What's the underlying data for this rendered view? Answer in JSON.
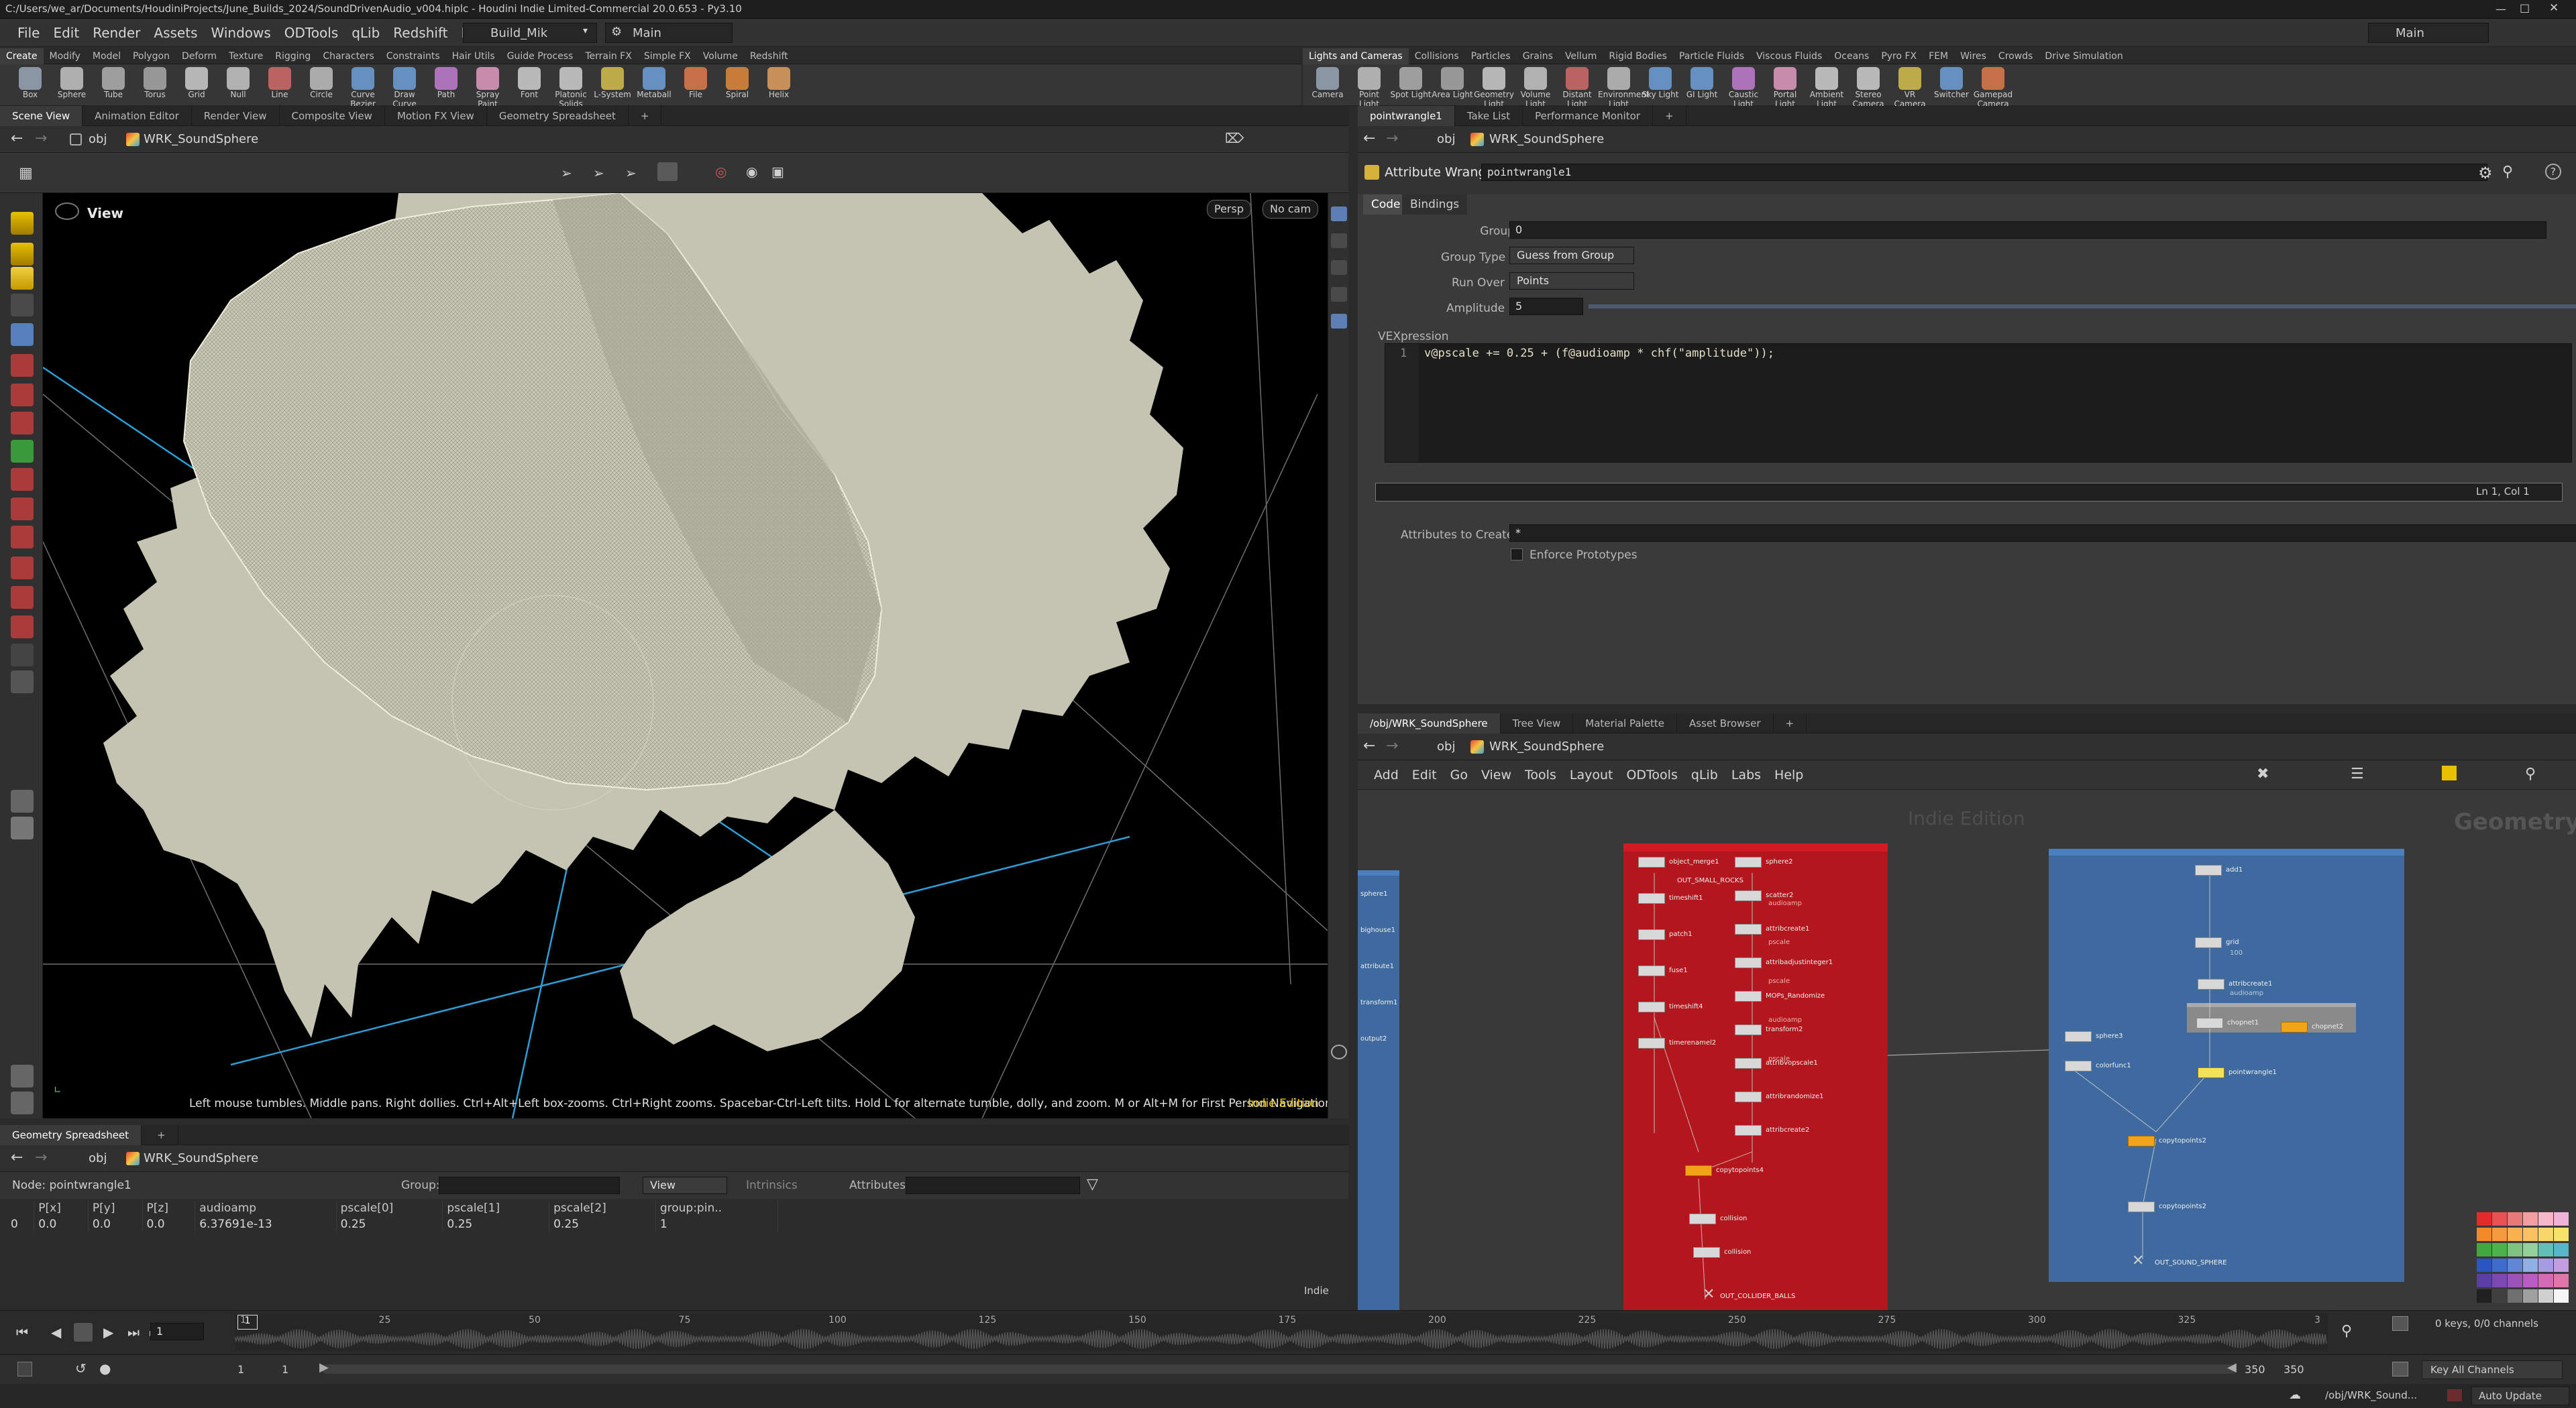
{
  "window": {
    "title": "C:/Users/we_ar/Documents/HoudiniProjects/June_Builds_2024/SoundDrivenAudio_v004.hiplc - Houdini Indie Limited-Commercial 20.0.653 - Py3.10"
  },
  "menu": {
    "items": [
      "File",
      "Edit",
      "Render",
      "Assets",
      "Windows",
      "ODTools",
      "qLib",
      "Redshift",
      "Labs",
      "Help"
    ],
    "desktop": "Build_Mik",
    "main_selector": "Main",
    "right_desktop": "Main"
  },
  "shelf_left": {
    "tabs": [
      "Create",
      "Modify",
      "Model",
      "Polygon",
      "Deform",
      "Texture",
      "Rigging",
      "Characters",
      "Constraints",
      "Hair Utils",
      "Guide Process",
      "Terrain FX",
      "Simple FX",
      "Volume",
      "Redshift"
    ],
    "tools": [
      "Box",
      "Sphere",
      "Tube",
      "Torus",
      "Grid",
      "Null",
      "Line",
      "Circle",
      "Curve Bezier",
      "Draw Curve",
      "Path",
      "Spray Paint",
      "Font",
      "Platonic Solids",
      "L-System",
      "Metaball",
      "File",
      "Spiral",
      "Helix"
    ]
  },
  "shelf_right": {
    "tabs": [
      "Lights and Cameras",
      "Collisions",
      "Particles",
      "Grains",
      "Vellum",
      "Rigid Bodies",
      "Particle Fluids",
      "Viscous Fluids",
      "Oceans",
      "Pyro FX",
      "FEM",
      "Wires",
      "Crowds",
      "Drive Simulation"
    ],
    "tools": [
      "Camera",
      "Point Light",
      "Spot Light",
      "Area Light",
      "Geometry Light",
      "Volume Light",
      "Distant Light",
      "Environment Light",
      "Sky Light",
      "GI Light",
      "Caustic Light",
      "Portal Light",
      "Ambient Light",
      "Stereo Camera",
      "VR Camera",
      "Switcher",
      "Gamepad Camera"
    ]
  },
  "scene_tabs": [
    "Scene View",
    "Animation Editor",
    "Render View",
    "Composite View",
    "Motion FX View",
    "Geometry Spreadsheet"
  ],
  "param_tabs": [
    "pointwrangle1",
    "Take List",
    "Performance Monitor"
  ],
  "network_tabs": [
    "/obj/WRK_SoundSphere",
    "Tree View",
    "Material Palette",
    "Asset Browser"
  ],
  "path": {
    "context": "obj",
    "node": "WRK_SoundSphere"
  },
  "viewport": {
    "label": "View",
    "persp": "Persp",
    "cam": "No cam",
    "hint": "Left mouse tumbles. Middle pans. Right dollies. Ctrl+Alt+Left box-zooms. Ctrl+Right zooms. Spacebar-Ctrl-Left tilts. Hold L for alternate tumble, dolly, and zoom.  M or Alt+M for First Person Navigation.",
    "edition": "Indie Edition"
  },
  "params": {
    "type_label": "Attribute Wrangle",
    "node_name": "pointwrangle1",
    "tabs": [
      "Code",
      "Bindings"
    ],
    "group_label": "Group",
    "group_value": "0",
    "group_type_label": "Group Type",
    "group_type_value": "Guess from Group",
    "run_over_label": "Run Over",
    "run_over_value": "Points",
    "amplitude_label": "Amplitude",
    "amplitude_value": "5",
    "vex_label": "VEXpression",
    "code_line_no": "1",
    "code": "v@pscale += 0.25 + (f@audioamp * chf(\"amplitude\"));",
    "cursor_pos": "Ln 1, Col 1",
    "attrs_label": "Attributes to Create",
    "attrs_value": "*",
    "enforce_label": "Enforce Prototypes"
  },
  "network": {
    "menu": [
      "Add",
      "Edit",
      "Go",
      "View",
      "Tools",
      "Layout",
      "ODTools",
      "qLib",
      "Labs",
      "Help"
    ],
    "watermark": "Indie Edition",
    "context_label": "Geometry",
    "left_nodes": [
      "sphere1",
      "bighouse1",
      "attribute1",
      "transform1",
      "output2"
    ],
    "red_col1": [
      "object_merge1",
      "timeshift1",
      "patch1",
      "fuse1",
      "timeshift4",
      "timerenamel2"
    ],
    "red_col1_sub": "OUT_SMALL_ROCKS",
    "red_col2": [
      "sphere2",
      "scatter2",
      "attribcreate1",
      "attribadjustinteger1",
      "MOPs_Randomize",
      "transform2",
      "attribvopscale1",
      "attribrandomize1",
      "attribcreate2"
    ],
    "red_col2_sub": [
      "audioamp",
      "pscale",
      "pscale",
      "audioamp",
      "pscale"
    ],
    "red_bottom": [
      "copytopoints4",
      "collision",
      "OUT_COLLIDER_BALLS"
    ],
    "blue_top": [
      "add1",
      "grid",
      "attribcreate1"
    ],
    "blue_top_sub": [
      "100",
      "audioamp"
    ],
    "blue_group": [
      "chopnet1",
      "chopnet2"
    ],
    "blue_left": [
      "sphere3",
      "colorfunc1"
    ],
    "blue_mid": [
      "pointwrangle1",
      "copytopoints2"
    ],
    "blue_out": "OUT_SOUND_SPHERE"
  },
  "spreadsheet": {
    "tab": "Geometry Spreadsheet",
    "node_label": "Node: pointwrangle1",
    "group_label": "Group:",
    "view_label": "View",
    "intrinsics_label": "Intrinsics",
    "attrs_label": "Attributes:",
    "columns": [
      "",
      "P[x]",
      "P[y]",
      "P[z]",
      "audioamp",
      "pscale[0]",
      "pscale[1]",
      "pscale[2]",
      "group:pin.."
    ],
    "rows": [
      [
        "0",
        "0.0",
        "0.0",
        "0.0",
        "6.37691e-13",
        "0.25",
        "0.25",
        "0.25",
        "1"
      ]
    ],
    "indie": "Indie"
  },
  "timeline": {
    "frame": "1",
    "ticks": [
      "1",
      "25",
      "50",
      "75",
      "100",
      "125",
      "150",
      "175",
      "200",
      "225",
      "250",
      "275",
      "300",
      "325",
      "3"
    ],
    "range_start": "1",
    "range_start2": "1",
    "range_end": "350",
    "range_end2": "350",
    "keys_info": "0 keys, 0/0 channels",
    "key_all": "Key All Channels",
    "status_path": "/obj/WRK_Sound...",
    "auto_update": "Auto Update"
  },
  "colors": {
    "red_box": "#b3161c",
    "red_header": "#d11a22",
    "blue_box": "#3e6a9f",
    "blue_header": "#4a7fc0",
    "mesh": "#c9c8b6",
    "accent_yellow": "#e8c000"
  },
  "palette": [
    "#e52a2a",
    "#e85252",
    "#e97979",
    "#f0a0a0",
    "#f4b7c9",
    "#f0b3d8",
    "#f38a2a",
    "#f59b3e",
    "#f7b14f",
    "#f9c363",
    "#f8d76a",
    "#f5e36a",
    "#3fa83f",
    "#4ab44a",
    "#7dc27d",
    "#94d19a",
    "#62c0b8",
    "#57b7c8",
    "#2b56c2",
    "#3f6ccc",
    "#5f87d6",
    "#8eb0e3",
    "#a59be0",
    "#c49ce0",
    "#5a3ea3",
    "#7a4ab1",
    "#9a54b8",
    "#b65ec1",
    "#d36bb7",
    "#e077a8",
    "#202020",
    "#404040",
    "#707070",
    "#a0a0a0",
    "#d0d0d0",
    "#f5f5f5"
  ]
}
